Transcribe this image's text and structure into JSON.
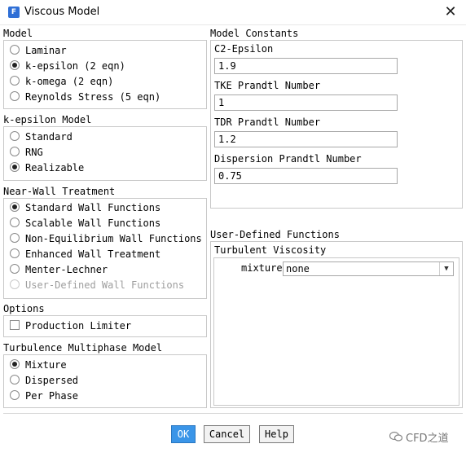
{
  "window": {
    "title": "Viscous Model",
    "icon_letter": "F"
  },
  "model": {
    "title": "Model",
    "options": [
      "Laminar",
      "k-epsilon (2 eqn)",
      "k-omega (2 eqn)",
      "Reynolds Stress (5 eqn)"
    ],
    "selected": 1
  },
  "kepsilon_model": {
    "title": "k-epsilon Model",
    "options": [
      "Standard",
      "RNG",
      "Realizable"
    ],
    "selected": 2
  },
  "near_wall": {
    "title": "Near-Wall Treatment",
    "options": [
      "Standard Wall Functions",
      "Scalable Wall Functions",
      "Non-Equilibrium Wall Functions",
      "Enhanced Wall Treatment",
      "Menter-Lechner",
      "User-Defined Wall Functions"
    ],
    "selected": 0,
    "disabled_index": 5
  },
  "options": {
    "title": "Options",
    "production_limiter": "Production Limiter",
    "production_limiter_checked": false
  },
  "multiphase": {
    "title": "Turbulence Multiphase Model",
    "options": [
      "Mixture",
      "Dispersed",
      "Per Phase"
    ],
    "selected": 0
  },
  "constants": {
    "title": "Model Constants",
    "c2_label": "C2-Epsilon",
    "c2_value": "1.9",
    "tke_label": "TKE Prandtl Number",
    "tke_value": "1",
    "tdr_label": "TDR Prandtl Number",
    "tdr_value": "1.2",
    "disp_label": "Dispersion Prandtl Number",
    "disp_value": "0.75"
  },
  "udf": {
    "title": "User-Defined Functions",
    "turbulent_viscosity": "Turbulent Viscosity",
    "mixture_label": "mixture",
    "mixture_value": "none"
  },
  "buttons": {
    "ok": "OK",
    "cancel": "Cancel",
    "help": "Help"
  },
  "watermark": "CFD之道",
  "colors": {
    "accent": "#3a95e8",
    "app_icon": "#2f6fd6"
  }
}
